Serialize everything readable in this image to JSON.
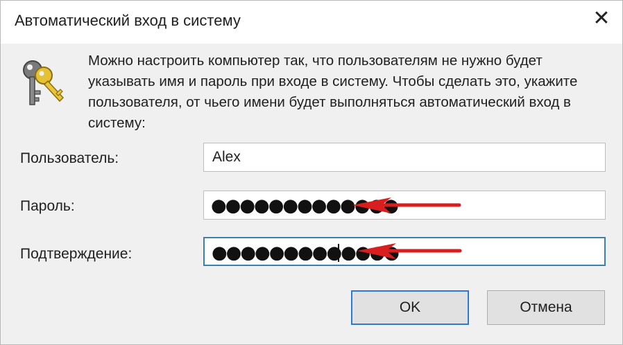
{
  "window": {
    "title": "Автоматический вход в систему"
  },
  "description": "Можно настроить компьютер так, что пользователям не нужно будет указывать имя и пароль при входе в систему. Чтобы сделать это, укажите пользователя, от чьего имени будет выполняться автоматический вход в систему:",
  "form": {
    "user_label": "Пользователь:",
    "user_value": "Alex",
    "password_label": "Пароль:",
    "password_masked": "●●●●●●●●●●●●●",
    "confirm_label": "Подтверждение:",
    "confirm_masked": "●●●●●●●●●●●●●"
  },
  "buttons": {
    "ok": "OK",
    "cancel": "Отмена"
  },
  "icons": {
    "close": "close-icon",
    "keys": "keys-icon",
    "arrow": "red-arrow-icon"
  },
  "colors": {
    "arrow": "#d81e1e",
    "focus_border": "#3c7fb1",
    "default_button_border": "#2d7ad6"
  }
}
